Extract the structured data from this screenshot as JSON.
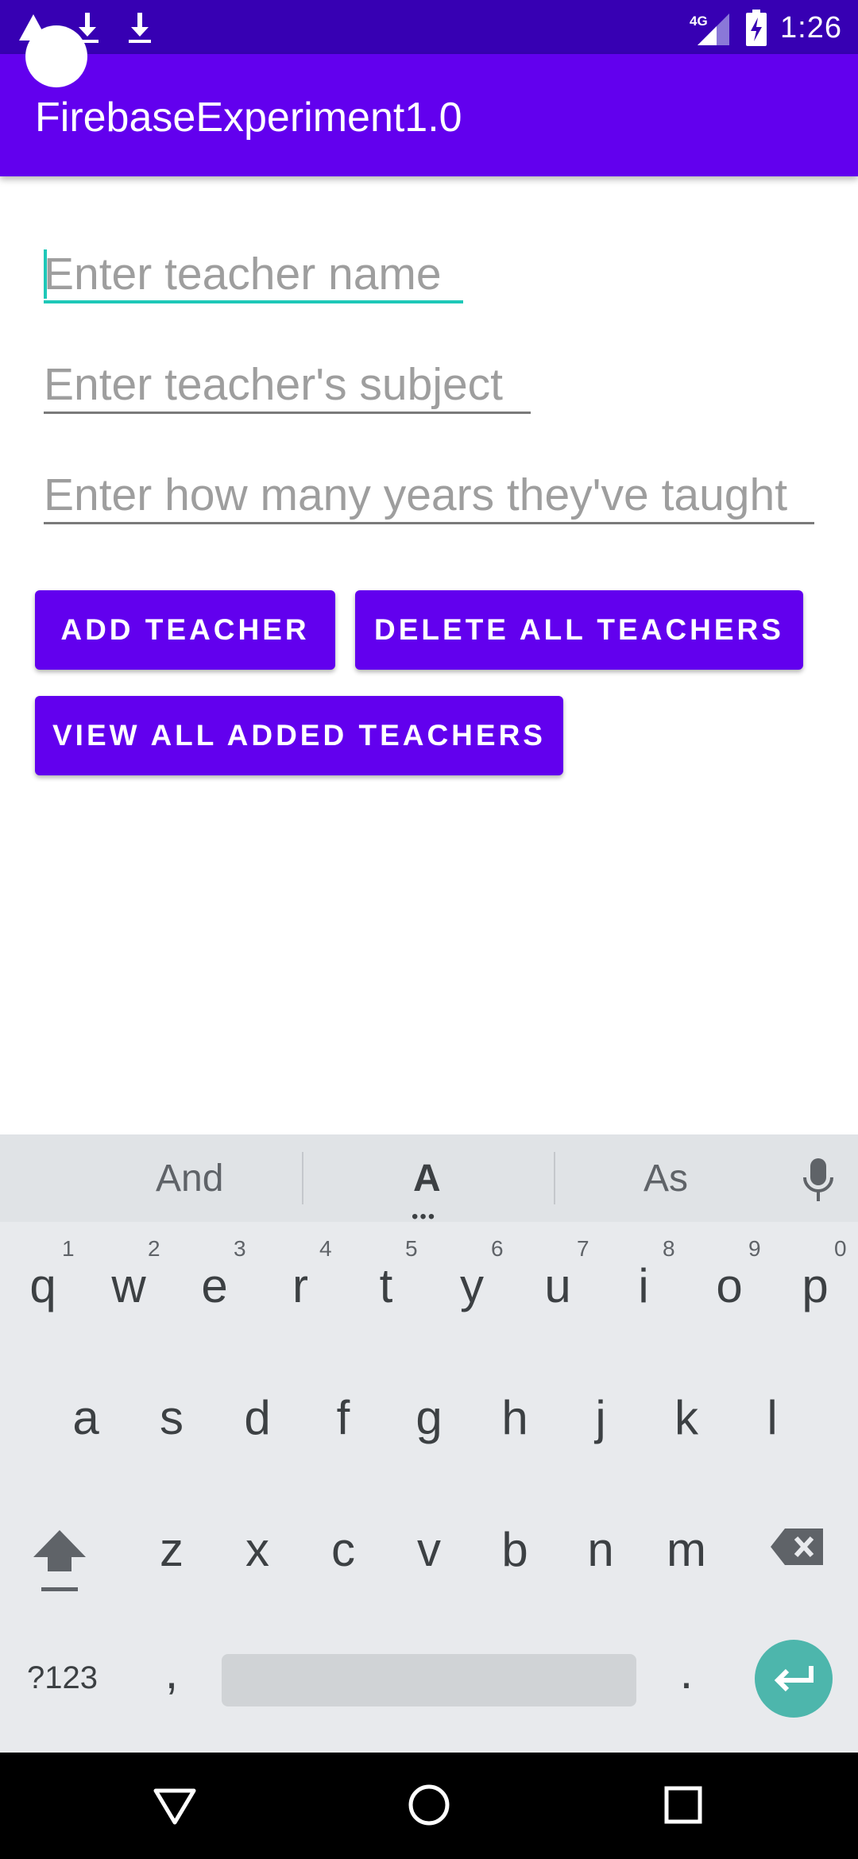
{
  "status_bar": {
    "time": "1:26",
    "network": "4G",
    "icons": [
      "warning-icon",
      "download-icon",
      "download-icon",
      "signal-icon",
      "battery-charging-icon"
    ]
  },
  "app_bar": {
    "title": "FirebaseExperiment1.0"
  },
  "form": {
    "name_placeholder": "Enter teacher name",
    "subject_placeholder": "Enter teacher's subject",
    "years_placeholder": "Enter how many years they've taught"
  },
  "buttons": {
    "add": "ADD TEACHER",
    "delete_all": "DELETE ALL TEACHERS",
    "view_all": "VIEW ALL ADDED TEACHERS"
  },
  "keyboard": {
    "suggestions": [
      "And",
      "A",
      "As"
    ],
    "row1": [
      {
        "key": "q",
        "hint": "1"
      },
      {
        "key": "w",
        "hint": "2"
      },
      {
        "key": "e",
        "hint": "3"
      },
      {
        "key": "r",
        "hint": "4"
      },
      {
        "key": "t",
        "hint": "5"
      },
      {
        "key": "y",
        "hint": "6"
      },
      {
        "key": "u",
        "hint": "7"
      },
      {
        "key": "i",
        "hint": "8"
      },
      {
        "key": "o",
        "hint": "9"
      },
      {
        "key": "p",
        "hint": "0"
      }
    ],
    "row2": [
      "a",
      "s",
      "d",
      "f",
      "g",
      "h",
      "j",
      "k",
      "l"
    ],
    "row3": [
      "z",
      "x",
      "c",
      "v",
      "b",
      "n",
      "m"
    ],
    "symbols_key": "?123",
    "comma_key": ",",
    "period_key": "."
  },
  "nav_bar": {
    "icons": [
      "back-icon",
      "home-icon",
      "recents-icon"
    ]
  },
  "colors": {
    "status_bar": "#3700b3",
    "primary": "#6200ee",
    "accent": "#1ec8b8",
    "keyboard_bg": "#e8eaed",
    "enter_key": "#4db6ac"
  }
}
